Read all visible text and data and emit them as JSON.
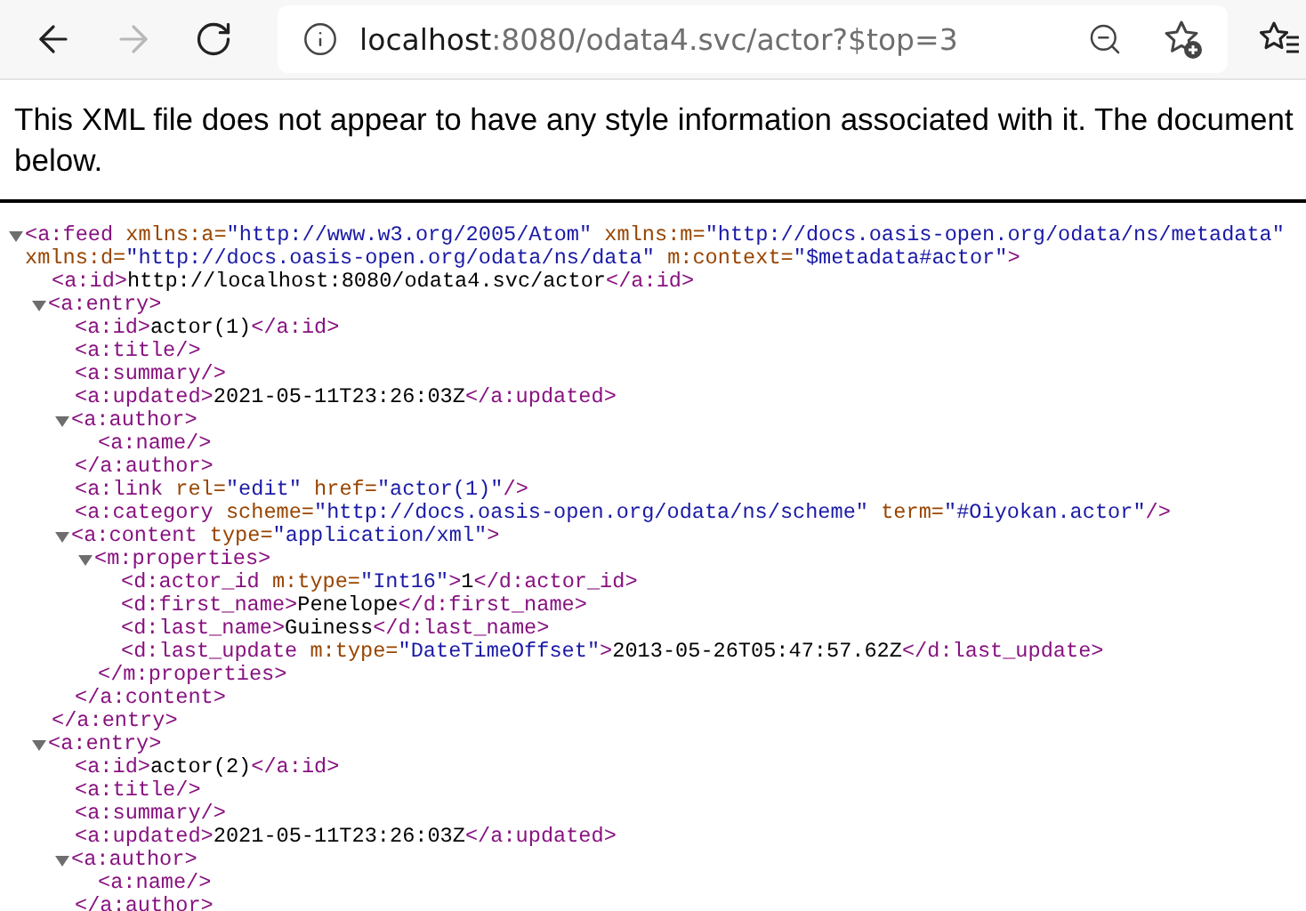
{
  "toolbar": {
    "back": {
      "disabled": false
    },
    "forward": {
      "disabled": true
    },
    "address": {
      "host": "localhost",
      "path": ":8080/odata4.svc/actor?$top=3"
    }
  },
  "notice": {
    "lines": [
      "This XML file does not appear to have any style information associated with it. The document",
      "below."
    ]
  },
  "xml": {
    "expanded": true,
    "line": [
      {
        "kind": "tag",
        "text": "<a:feed"
      },
      {
        "kind": "attr",
        "text": " xmlns:a="
      },
      {
        "kind": "value",
        "text": "\"http://www.w3.org/2005/Atom\""
      },
      {
        "kind": "attr",
        "text": " xmlns:m="
      },
      {
        "kind": "value",
        "text": "\"http://docs.oasis-open.org/odata/ns/metadata\""
      },
      {
        "kind": "attr",
        "text": " xmlns:d="
      },
      {
        "kind": "value",
        "text": "\"http://docs.oasis-open.org/odata/ns/data\""
      },
      {
        "kind": "attr",
        "text": " m:context="
      },
      {
        "kind": "value",
        "text": "\"$metadata#actor\""
      },
      {
        "kind": "tag",
        "text": ">"
      }
    ],
    "children": [
      {
        "line": [
          {
            "kind": "tag",
            "text": "<a:id>"
          },
          {
            "kind": "text",
            "text": "http://localhost:8080/odata4.svc/actor"
          },
          {
            "kind": "tag",
            "text": "</a:id>"
          }
        ]
      },
      {
        "expanded": true,
        "line": [
          {
            "kind": "tag",
            "text": "<a:entry>"
          }
        ],
        "close": [
          {
            "kind": "tag",
            "text": "</a:entry>"
          }
        ],
        "children": [
          {
            "line": [
              {
                "kind": "tag",
                "text": "<a:id>"
              },
              {
                "kind": "text",
                "text": "actor(1)"
              },
              {
                "kind": "tag",
                "text": "</a:id>"
              }
            ]
          },
          {
            "line": [
              {
                "kind": "tag",
                "text": "<a:title/>"
              }
            ]
          },
          {
            "line": [
              {
                "kind": "tag",
                "text": "<a:summary/>"
              }
            ]
          },
          {
            "line": [
              {
                "kind": "tag",
                "text": "<a:updated>"
              },
              {
                "kind": "text",
                "text": "2021-05-11T23:26:03Z"
              },
              {
                "kind": "tag",
                "text": "</a:updated>"
              }
            ]
          },
          {
            "expanded": true,
            "line": [
              {
                "kind": "tag",
                "text": "<a:author>"
              }
            ],
            "close": [
              {
                "kind": "tag",
                "text": "</a:author>"
              }
            ],
            "children": [
              {
                "line": [
                  {
                    "kind": "tag",
                    "text": "<a:name/>"
                  }
                ]
              }
            ]
          },
          {
            "line": [
              {
                "kind": "tag",
                "text": "<a:link"
              },
              {
                "kind": "attr",
                "text": " rel="
              },
              {
                "kind": "value",
                "text": "\"edit\""
              },
              {
                "kind": "attr",
                "text": " href="
              },
              {
                "kind": "value",
                "text": "\"actor(1)\""
              },
              {
                "kind": "tag",
                "text": "/>"
              }
            ]
          },
          {
            "line": [
              {
                "kind": "tag",
                "text": "<a:category"
              },
              {
                "kind": "attr",
                "text": " scheme="
              },
              {
                "kind": "value",
                "text": "\"http://docs.oasis-open.org/odata/ns/scheme\""
              },
              {
                "kind": "attr",
                "text": " term="
              },
              {
                "kind": "value",
                "text": "\"#Oiyokan.actor\""
              },
              {
                "kind": "tag",
                "text": "/>"
              }
            ]
          },
          {
            "expanded": true,
            "line": [
              {
                "kind": "tag",
                "text": "<a:content"
              },
              {
                "kind": "attr",
                "text": " type="
              },
              {
                "kind": "value",
                "text": "\"application/xml\""
              },
              {
                "kind": "tag",
                "text": ">"
              }
            ],
            "close": [
              {
                "kind": "tag",
                "text": "</a:content>"
              }
            ],
            "children": [
              {
                "expanded": true,
                "line": [
                  {
                    "kind": "tag",
                    "text": "<m:properties>"
                  }
                ],
                "close": [
                  {
                    "kind": "tag",
                    "text": "</m:properties>"
                  }
                ],
                "children": [
                  {
                    "line": [
                      {
                        "kind": "tag",
                        "text": "<d:actor_id"
                      },
                      {
                        "kind": "attr",
                        "text": " m:type="
                      },
                      {
                        "kind": "value",
                        "text": "\"Int16\""
                      },
                      {
                        "kind": "tag",
                        "text": ">"
                      },
                      {
                        "kind": "text",
                        "text": "1"
                      },
                      {
                        "kind": "tag",
                        "text": "</d:actor_id>"
                      }
                    ]
                  },
                  {
                    "line": [
                      {
                        "kind": "tag",
                        "text": "<d:first_name>"
                      },
                      {
                        "kind": "text",
                        "text": "Penelope"
                      },
                      {
                        "kind": "tag",
                        "text": "</d:first_name>"
                      }
                    ]
                  },
                  {
                    "line": [
                      {
                        "kind": "tag",
                        "text": "<d:last_name>"
                      },
                      {
                        "kind": "text",
                        "text": "Guiness"
                      },
                      {
                        "kind": "tag",
                        "text": "</d:last_name>"
                      }
                    ]
                  },
                  {
                    "line": [
                      {
                        "kind": "tag",
                        "text": "<d:last_update"
                      },
                      {
                        "kind": "attr",
                        "text": " m:type="
                      },
                      {
                        "kind": "value",
                        "text": "\"DateTimeOffset\""
                      },
                      {
                        "kind": "tag",
                        "text": ">"
                      },
                      {
                        "kind": "text",
                        "text": "2013-05-26T05:47:57.62Z"
                      },
                      {
                        "kind": "tag",
                        "text": "</d:last_update>"
                      }
                    ]
                  }
                ]
              }
            ]
          }
        ]
      },
      {
        "expanded": true,
        "line": [
          {
            "kind": "tag",
            "text": "<a:entry>"
          }
        ],
        "children": [
          {
            "line": [
              {
                "kind": "tag",
                "text": "<a:id>"
              },
              {
                "kind": "text",
                "text": "actor(2)"
              },
              {
                "kind": "tag",
                "text": "</a:id>"
              }
            ]
          },
          {
            "line": [
              {
                "kind": "tag",
                "text": "<a:title/>"
              }
            ]
          },
          {
            "line": [
              {
                "kind": "tag",
                "text": "<a:summary/>"
              }
            ]
          },
          {
            "line": [
              {
                "kind": "tag",
                "text": "<a:updated>"
              },
              {
                "kind": "text",
                "text": "2021-05-11T23:26:03Z"
              },
              {
                "kind": "tag",
                "text": "</a:updated>"
              }
            ]
          },
          {
            "expanded": true,
            "line": [
              {
                "kind": "tag",
                "text": "<a:author>"
              }
            ],
            "close": [
              {
                "kind": "tag",
                "text": "</a:author>"
              }
            ],
            "children": [
              {
                "line": [
                  {
                    "kind": "tag",
                    "text": "<a:name/>"
                  }
                ]
              }
            ]
          }
        ]
      }
    ]
  }
}
